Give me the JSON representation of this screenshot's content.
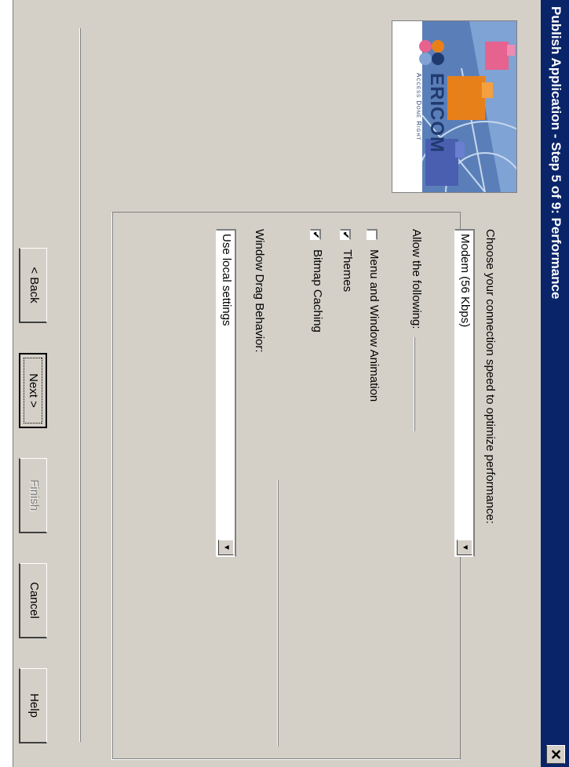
{
  "window": {
    "title": "Publish Application - Step 5 of 9: Performance",
    "close_label": "✕"
  },
  "banner": {
    "logo_text": "ERICOM",
    "tagline": "Access Done Right"
  },
  "performance": {
    "connection_label": "Choose your connection speed to optimize performance:",
    "connection_value": "Modem (56 Kbps)",
    "allow_label": "Allow the following:",
    "options": [
      {
        "label": "Menu and Window Animation",
        "checked": false
      },
      {
        "label": "Themes",
        "checked": true
      },
      {
        "label": "Bitmap Caching",
        "checked": true
      }
    ],
    "drag_label": "Window Drag Behavior:",
    "drag_value": "Use local settings"
  },
  "buttons": {
    "back": "< Back",
    "next": "Next >",
    "finish": "Finish",
    "cancel": "Cancel",
    "help": "Help"
  },
  "colors": {
    "titlebar": "#0a246a",
    "dialog_bg": "#d4d0c8"
  }
}
